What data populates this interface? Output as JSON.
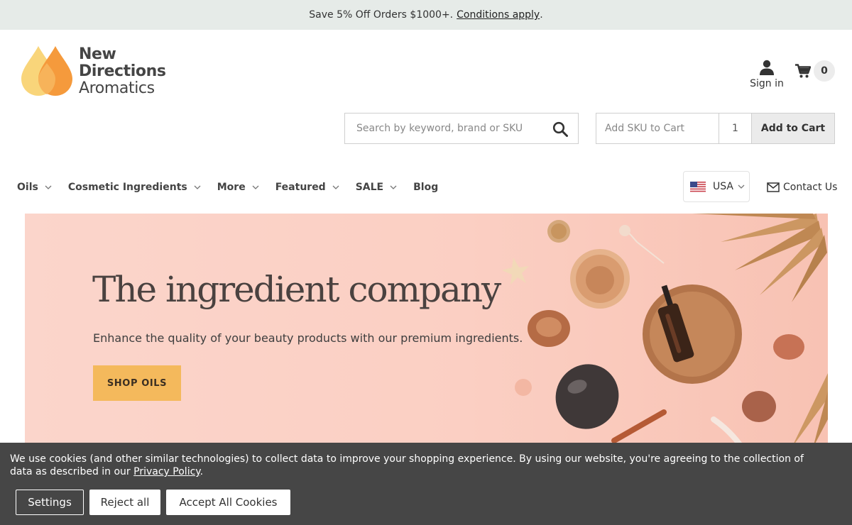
{
  "promo": {
    "text": "Save 5% Off Orders $1000+.",
    "link": "Conditions apply",
    "suffix": "."
  },
  "logo": {
    "line1": "New",
    "line2": "Directions",
    "line3": "Aromatics"
  },
  "header": {
    "signin": "Sign in",
    "cart_count": "0"
  },
  "search": {
    "placeholder": "Search by keyword, brand or SKU",
    "icon": "search-icon"
  },
  "sku": {
    "placeholder": "Add SKU to Cart",
    "qty": "1",
    "button": "Add to Cart"
  },
  "nav": [
    {
      "label": "Oils"
    },
    {
      "label": "Cosmetic Ingredients"
    },
    {
      "label": "More"
    },
    {
      "label": "Featured"
    },
    {
      "label": "SALE"
    },
    {
      "label": "Blog"
    }
  ],
  "country": {
    "label": "USA"
  },
  "contact": {
    "label": "Contact Us"
  },
  "hero": {
    "title": "The ingredient company",
    "subtitle": "Enhance the quality of your beauty products with our premium ingredients.",
    "button": "SHOP OILS"
  },
  "cookie": {
    "message": "We use cookies (and other similar technologies) to collect data to improve your shopping experience. By using our website, you're agreeing to the collection of data as described in our",
    "link": "Privacy Policy",
    "suffix": ".",
    "settings": "Settings",
    "reject": "Reject all",
    "accept": "Accept All Cookies"
  },
  "colors": {
    "accent": "#f4b95c",
    "hero_bg": "#fbd5cb",
    "banner_bg": "#464646",
    "promo_bg": "#e6ebe8"
  }
}
